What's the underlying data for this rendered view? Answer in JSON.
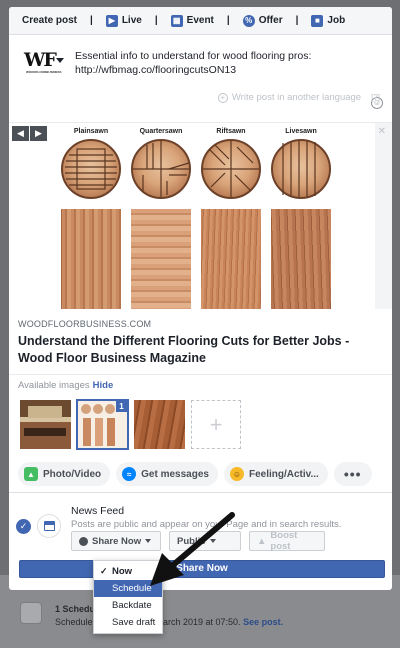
{
  "tabs": [
    {
      "label": "Create post",
      "icon": ""
    },
    {
      "label": "Live",
      "icon": "video-icon"
    },
    {
      "label": "Event",
      "icon": "calendar-icon"
    },
    {
      "label": "Offer",
      "icon": "offer-icon"
    },
    {
      "label": "Job",
      "icon": "briefcase-icon"
    }
  ],
  "composer": {
    "page_logo_text": "WF",
    "page_logo_subtext": "WOODFLOORBUSINESS",
    "post_text": "Essential info to understand for wood flooring pros: http://wfbmag.co/flooringcutsON13",
    "translate_label": "Write post in another language",
    "help_label": "[?]"
  },
  "preview": {
    "cuts": [
      "Plainsawn",
      "Quartersawn",
      "Riftsawn",
      "Livesawn"
    ],
    "domain": "WOODFLOORBUSINESS.COM",
    "title": "Understand the Different Flooring Cuts for Better Jobs - Wood Floor Business Magazine",
    "prev_label": "◀",
    "next_label": "▶",
    "close_label": "✕"
  },
  "images": {
    "available_label": "Available images",
    "hide_label": "Hide",
    "selected_badge": "1",
    "add_label": "+"
  },
  "actions": [
    {
      "label": "Photo/Video",
      "icon": "photo-icon",
      "color": "#45bd62"
    },
    {
      "label": "Get messages",
      "icon": "messenger-icon",
      "color": "#0084ff"
    },
    {
      "label": "Feeling/Activ...",
      "icon": "feeling-icon",
      "color": "#f7b928"
    },
    {
      "label": "•••",
      "icon": "more-icon",
      "color": ""
    }
  ],
  "news_feed": {
    "title": "News Feed",
    "description": "Posts are public and appear on your Page and in search results.",
    "share_label": "Share Now",
    "audience_label": "Public",
    "boost_label": "Boost post",
    "primary_button": "Share Now"
  },
  "share_menu": {
    "items": [
      {
        "label": "Now",
        "checked": true,
        "active": false
      },
      {
        "label": "Schedule",
        "checked": false,
        "active": true
      },
      {
        "label": "Backdate",
        "checked": false,
        "active": false
      },
      {
        "label": "Save draft",
        "checked": false,
        "active": false
      }
    ]
  },
  "background": {
    "scheduled_title": "1 Scheduled",
    "scheduled_prefix": "Schedule",
    "scheduled_date": "8 March 2019 at 07:50.",
    "see_post": "See post."
  },
  "colors": {
    "accent": "#4267b2",
    "backdrop": "#6e6f72"
  }
}
